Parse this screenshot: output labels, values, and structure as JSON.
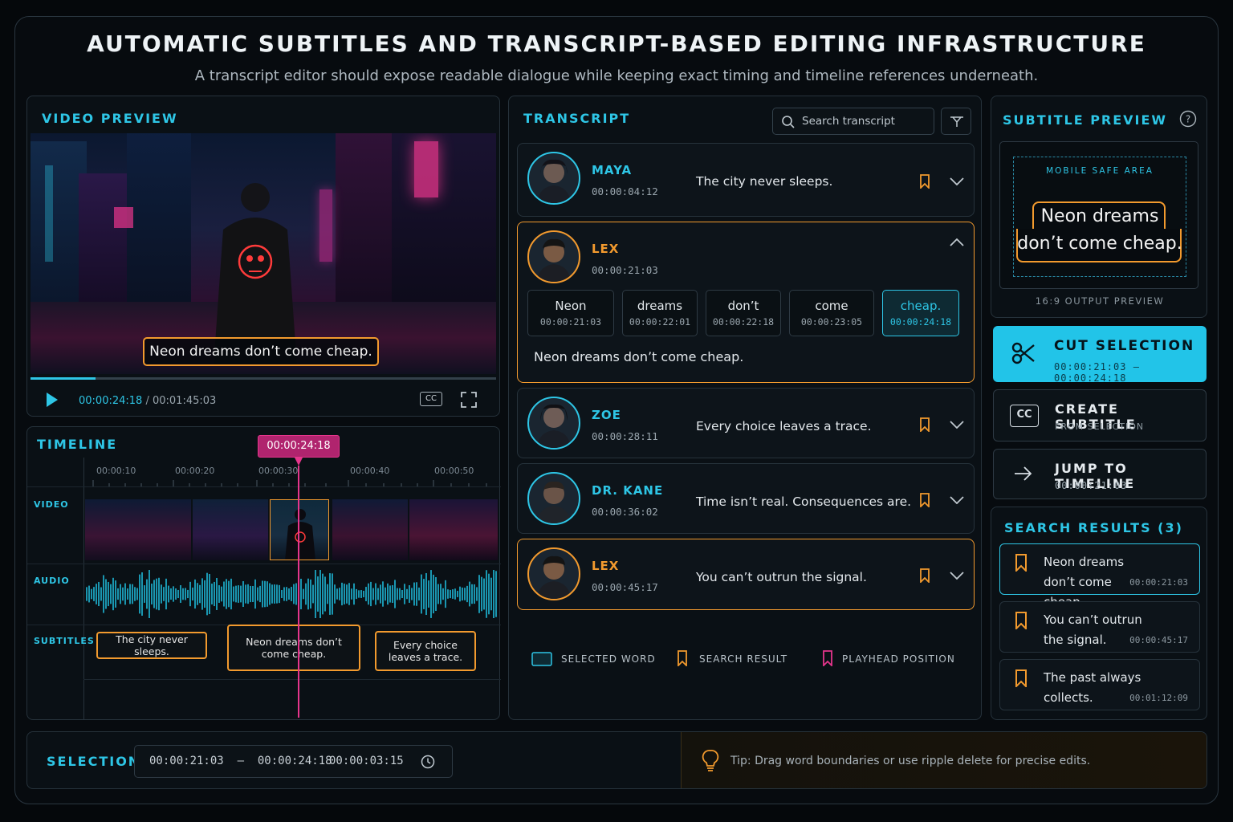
{
  "header": {
    "title": "AUTOMATIC SUBTITLES AND TRANSCRIPT-BASED EDITING INFRASTRUCTURE",
    "subtitle": "A transcript editor should expose readable dialogue while keeping exact timing and timeline references underneath."
  },
  "video_preview": {
    "title": "VIDEO PREVIEW",
    "caption": "Neon dreams don’t come cheap.",
    "current_time": "00:00:24:18",
    "separator": "/",
    "duration": "00:01:45:03",
    "progress": 0.14,
    "cc_label": "CC",
    "play_icon": "play-icon",
    "fullscreen_icon": "fullscreen-icon"
  },
  "timeline": {
    "title": "TIMELINE",
    "playhead_time": "00:00:24:18",
    "ticks": [
      "00:00:10",
      "00:00:20",
      "00:00:30",
      "00:00:40",
      "00:00:50"
    ],
    "track_labels": {
      "video": "VIDEO",
      "audio": "AUDIO",
      "subtitles": "SUBTITLES"
    },
    "subtitle_clips": [
      {
        "text": "The city never sleeps."
      },
      {
        "text": "Neon dreams don’t come cheap."
      },
      {
        "text": "Every choice leaves a trace."
      }
    ]
  },
  "transcript": {
    "title": "TRANSCRIPT",
    "search_placeholder": "Search transcript",
    "entries": [
      {
        "speaker": "MAYA",
        "time": "00:00:04:12",
        "text": "The city never sleeps."
      },
      {
        "speaker": "LEX",
        "time": "00:00:21:03",
        "text": "Neon dreams don’t come cheap.",
        "words": [
          {
            "w": "Neon",
            "t": "00:00:21:03"
          },
          {
            "w": "dreams",
            "t": "00:00:22:01"
          },
          {
            "w": "don’t",
            "t": "00:00:22:18"
          },
          {
            "w": "come",
            "t": "00:00:23:05"
          },
          {
            "w": "cheap.",
            "t": "00:00:24:18"
          }
        ]
      },
      {
        "speaker": "ZOE",
        "time": "00:00:28:11",
        "text": "Every choice leaves a trace."
      },
      {
        "speaker": "DR. KANE",
        "time": "00:00:36:02",
        "text": "Time isn’t real. Consequences are."
      },
      {
        "speaker": "LEX",
        "time": "00:00:45:17",
        "text": "You can’t outrun the signal."
      }
    ],
    "legend": {
      "selected_word": "SELECTED WORD",
      "search_result": "SEARCH RESULT",
      "playhead_position": "PLAYHEAD POSITION"
    }
  },
  "subtitle_preview": {
    "title": "SUBTITLE PREVIEW",
    "safe_area": "MOBILE SAFE AREA",
    "line1": "Neon dreams",
    "line2": "don’t come cheap.",
    "footer": "16:9 OUTPUT PREVIEW"
  },
  "actions": {
    "cut": {
      "label": "CUT SELECTION",
      "sub": "00:00:21:03 – 00:00:24:18"
    },
    "create_subtitle": {
      "label": "CREATE SUBTITLE",
      "sub": "FROM SELECTION",
      "icon_text": "CC"
    },
    "jump": {
      "label": "JUMP TO TIMELINE",
      "sub": "00:00:21:03"
    }
  },
  "search_results": {
    "title": "SEARCH RESULTS (3)",
    "items": [
      {
        "text": "Neon dreams don’t come cheap.",
        "time": "00:00:21:03"
      },
      {
        "text": "You can’t outrun the signal.",
        "time": "00:00:45:17"
      },
      {
        "text": "The past always collects.",
        "time": "00:01:12:09"
      }
    ]
  },
  "selection_bar": {
    "label": "SELECTION",
    "range": "00:00:21:03  –  00:00:24:18",
    "duration": "00:00:03:15",
    "tip": "Tip: Drag word boundaries or use ripple delete for precise edits."
  },
  "colors": {
    "accent": "#2ec6e6",
    "highlight": "#f29a2e",
    "playhead": "#e6358c"
  }
}
